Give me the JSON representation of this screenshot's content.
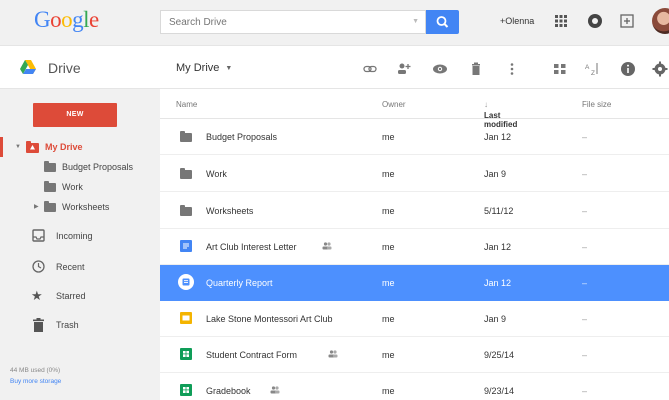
{
  "topbar": {
    "logo_letters": [
      {
        "ch": "G",
        "color": "#4285f4"
      },
      {
        "ch": "o",
        "color": "#ea4335"
      },
      {
        "ch": "o",
        "color": "#fbbc05"
      },
      {
        "ch": "g",
        "color": "#4285f4"
      },
      {
        "ch": "l",
        "color": "#34a853"
      },
      {
        "ch": "e",
        "color": "#ea4335"
      }
    ],
    "search_placeholder": "Search Drive",
    "user": "+Olenna",
    "icons": [
      "apps-grid-icon",
      "notifications-icon",
      "share-box-icon"
    ]
  },
  "subbar": {
    "app_name": "Drive",
    "breadcrumb": "My Drive",
    "toolbar_icons": [
      "get-link-icon",
      "add-people-icon",
      "preview-icon",
      "delete-icon",
      "more-icon",
      "grid-view-icon",
      "sort-icon",
      "details-icon",
      "settings-icon"
    ]
  },
  "sidebar": {
    "new_label": "NEW",
    "items": [
      {
        "label": "My Drive",
        "active": true
      },
      {
        "label": "Budget Proposals"
      },
      {
        "label": "Work"
      },
      {
        "label": "Worksheets"
      },
      {
        "label": "Incoming"
      },
      {
        "label": "Recent"
      },
      {
        "label": "Starred"
      },
      {
        "label": "Trash"
      }
    ],
    "storage": "44 MB used (0%)",
    "buy": "Buy more storage"
  },
  "list": {
    "headers": {
      "name": "Name",
      "owner": "Owner",
      "modified": "Last modified",
      "size": "File size",
      "sort_arrow": "↓"
    },
    "rows": [
      {
        "name": "Budget Proposals",
        "owner": "me",
        "modified": "Jan 12",
        "size": "–",
        "type": "folder"
      },
      {
        "name": "Work",
        "owner": "me",
        "modified": "Jan 9",
        "size": "–",
        "type": "folder"
      },
      {
        "name": "Worksheets",
        "owner": "me",
        "modified": "5/11/12",
        "size": "–",
        "type": "folder"
      },
      {
        "name": "Art Club Interest Letter",
        "owner": "me",
        "modified": "Jan 12",
        "size": "–",
        "type": "doc",
        "shared": true
      },
      {
        "name": "Quarterly Report",
        "owner": "me",
        "modified": "Jan 12",
        "size": "–",
        "type": "doc",
        "selected": true
      },
      {
        "name": "Lake Stone Montessori Art Club",
        "owner": "me",
        "modified": "Jan 9",
        "size": "–",
        "type": "slides"
      },
      {
        "name": "Student Contract Form",
        "owner": "me",
        "modified": "9/25/14",
        "size": "–",
        "type": "sheet",
        "shared": true
      },
      {
        "name": "Gradebook",
        "owner": "me",
        "modified": "9/23/14",
        "size": "–",
        "type": "sheet",
        "shared": true
      }
    ]
  },
  "colors": {
    "accent_blue": "#4285f4",
    "new_red": "#dd4b39",
    "selection": "#4d90fe",
    "doc_blue": "#4285f4",
    "slides_yellow": "#f4b400",
    "sheet_green": "#0f9d58"
  }
}
